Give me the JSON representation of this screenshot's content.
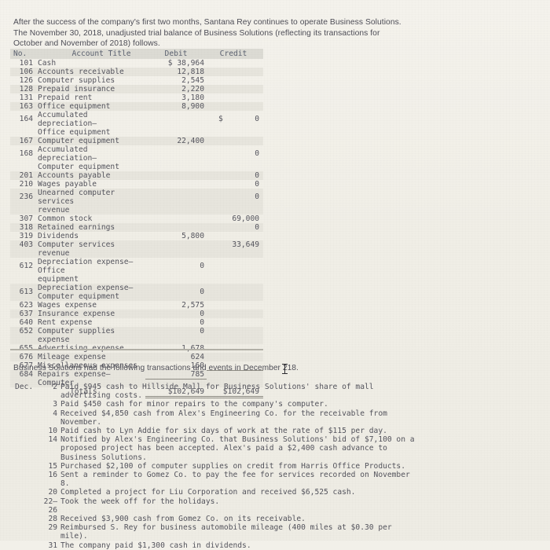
{
  "intro": {
    "paragraph": "After the success of the company's first two months, Santana Rey continues to operate Business Solutions. The November 30, 2018, unadjusted trial balance of Business Solutions (reflecting its transactions for October and November of 2018) follows."
  },
  "trial_balance": {
    "columns": {
      "no": "No.",
      "title": "Account Title",
      "debit": "Debit",
      "credit": "Credit"
    },
    "rows": [
      {
        "no": "101",
        "title": "Cash",
        "debit": "$ 38,964",
        "credit": ""
      },
      {
        "no": "106",
        "title": "Accounts receivable",
        "debit": "12,818",
        "credit": ""
      },
      {
        "no": "126",
        "title": "Computer supplies",
        "debit": "2,545",
        "credit": ""
      },
      {
        "no": "128",
        "title": "Prepaid insurance",
        "debit": "2,220",
        "credit": ""
      },
      {
        "no": "131",
        "title": "Prepaid rent",
        "debit": "3,180",
        "credit": ""
      },
      {
        "no": "163",
        "title": "Office equipment",
        "debit": "8,900",
        "credit": ""
      },
      {
        "no": "164",
        "title": "Accumulated depreciation—\nOffice equipment",
        "debit": "",
        "credit": "$       0"
      },
      {
        "no": "167",
        "title": "Computer equipment",
        "debit": "22,400",
        "credit": ""
      },
      {
        "no": "168",
        "title": "Accumulated depreciation—\nComputer equipment",
        "debit": "",
        "credit": "0"
      },
      {
        "no": "201",
        "title": "Accounts payable",
        "debit": "",
        "credit": "0"
      },
      {
        "no": "210",
        "title": "Wages payable",
        "debit": "",
        "credit": "0"
      },
      {
        "no": "236",
        "title": "Unearned computer services\nrevenue",
        "debit": "",
        "credit": "0"
      },
      {
        "no": "307",
        "title": "Common stock",
        "debit": "",
        "credit": "69,000"
      },
      {
        "no": "318",
        "title": "Retained earnings",
        "debit": "",
        "credit": "0"
      },
      {
        "no": "319",
        "title": "Dividends",
        "debit": "5,800",
        "credit": ""
      },
      {
        "no": "403",
        "title": "Computer services revenue",
        "debit": "",
        "credit": "33,649"
      },
      {
        "no": "612",
        "title": "Depreciation expense—Office\nequipment",
        "debit": "0",
        "credit": ""
      },
      {
        "no": "613",
        "title": "Depreciation expense—\nComputer equipment",
        "debit": "0",
        "credit": ""
      },
      {
        "no": "623",
        "title": "Wages expense",
        "debit": "2,575",
        "credit": ""
      },
      {
        "no": "637",
        "title": "Insurance expense",
        "debit": "0",
        "credit": ""
      },
      {
        "no": "640",
        "title": "Rent expense",
        "debit": "0",
        "credit": ""
      },
      {
        "no": "652",
        "title": "Computer supplies expense",
        "debit": "0",
        "credit": ""
      },
      {
        "no": "655",
        "title": "Advertising expense",
        "debit": "1,678",
        "credit": ""
      },
      {
        "no": "676",
        "title": "Mileage expense",
        "debit": "624",
        "credit": ""
      },
      {
        "no": "677",
        "title": "Miscellaneous expenses",
        "debit": "160",
        "credit": ""
      },
      {
        "no": "684",
        "title": "Repairs expense—Computer",
        "debit": "785",
        "credit": ""
      }
    ],
    "totals": {
      "label": "Totals",
      "debit": "$102,649",
      "credit": "$102,649"
    }
  },
  "december": {
    "intro_before": "Business Solutions had the following transactions and events in December 2",
    "intro_after": "18.",
    "month_label": "Dec.",
    "entries": [
      {
        "day": "2",
        "text": "Paid $945 cash to Hillside Mall for Business Solutions' share of mall\nadvertising costs."
      },
      {
        "day": "3",
        "text": "Paid $450 cash for minor repairs to the company's computer."
      },
      {
        "day": "4",
        "text": "Received $4,850 cash from Alex's Engineering Co. for the receivable from\nNovember."
      },
      {
        "day": "10",
        "text": "Paid cash to Lyn Addie for six days of work at the rate of $115 per day."
      },
      {
        "day": "14",
        "text": "Notified by Alex's Engineering Co. that Business Solutions' bid of $7,100 on a\nproposed project has been accepted. Alex's paid a $2,400 cash advance to\nBusiness Solutions."
      },
      {
        "day": "15",
        "text": "Purchased $2,100 of computer supplies on credit from Harris Office Products."
      },
      {
        "day": "16",
        "text": "Sent a reminder to Gomez Co. to pay the fee for services recorded on November\n8."
      },
      {
        "day": "20",
        "text": "Completed a project for Liu Corporation and received $6,525 cash."
      },
      {
        "day": "22—",
        "text": "Took the week off for the holidays."
      },
      {
        "day": "26",
        "text": ""
      },
      {
        "day": "28",
        "text": "Received $3,900 cash from Gomez Co. on its receivable."
      },
      {
        "day": "29",
        "text": "Reimbursed S. Rey for business automobile mileage (400 miles at $0.30 per\nmile)."
      },
      {
        "day": "31",
        "text": "The company paid $1,300 cash in dividends."
      }
    ]
  },
  "colors": {
    "paper": "#f2f0e9",
    "ink": "#53535c",
    "header_band": "#dcdbd4",
    "row_shade": "#e7e5dd",
    "rule": "#8e8c84"
  }
}
